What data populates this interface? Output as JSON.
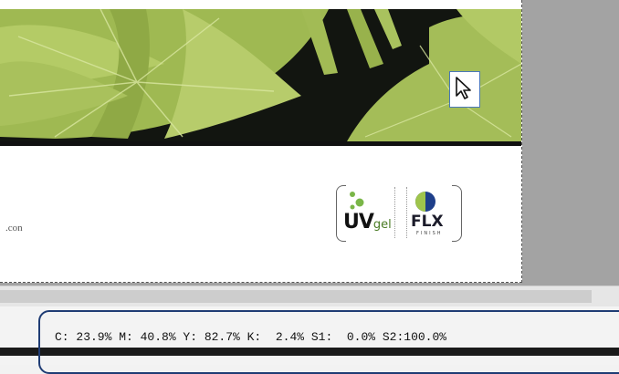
{
  "document": {
    "url_fragment": ".con",
    "logos": {
      "uvgel_main": "UV",
      "uvgel_sub": "gel",
      "flx_main": "FLX",
      "flx_sub": "FINISH"
    }
  },
  "status": {
    "readout": "C: 23.9% M: 40.8% Y: 82.7% K:  2.4% S1:  0.0% S2:100.0%"
  },
  "colors": {
    "leaf_green": "#a8c058",
    "background_black": "#121510",
    "highlight_blue": "#1f3c74",
    "uvgel_green": "#7ab648",
    "flx_blue": "#1e3f8a"
  },
  "icons": {
    "cursor": "arrow-cursor-icon"
  }
}
